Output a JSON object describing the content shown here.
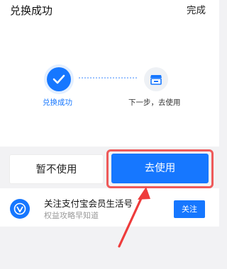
{
  "header": {
    "title": "兑换成功",
    "done_label": "完成"
  },
  "steps": [
    {
      "label": "兑换成功",
      "status": "done",
      "icon": "check-icon"
    },
    {
      "label": "下一步，去使用",
      "status": "pending",
      "icon": "store-icon"
    }
  ],
  "actions": {
    "secondary_label": "暂不使用",
    "primary_label": "去使用"
  },
  "follow_card": {
    "title": "关注支付宝会员生活号",
    "subtitle": "权益攻略早知道",
    "button_label": "关注",
    "icon": "alipay-membership-logo-icon"
  },
  "annotation": {
    "color": "#ee5a5a",
    "type": "arrow-pointing-to-primary-button"
  },
  "colors": {
    "accent": "#1677ff",
    "background": "#f2f2f4"
  }
}
